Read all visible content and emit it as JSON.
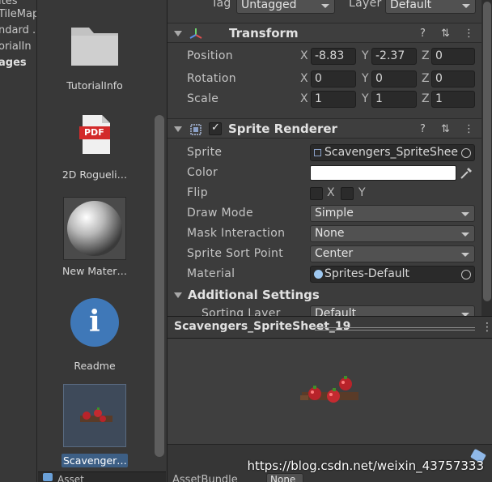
{
  "tree": {
    "items": [
      {
        "label": "ites"
      },
      {
        "label": "TileMap"
      },
      {
        "label": "ndard ."
      },
      {
        "label": "orialIn"
      },
      {
        "label": "ages"
      }
    ]
  },
  "assets": [
    {
      "label": "TutorialInfo",
      "icon": "folder-icon"
    },
    {
      "label": "2D Rogueli…",
      "icon": "pdf-icon",
      "badge": "PDF"
    },
    {
      "label": "New Mater…",
      "icon": "material-sphere-icon"
    },
    {
      "label": "Readme",
      "icon": "info-icon",
      "glyph": "i"
    },
    {
      "label": "Scavenger…",
      "icon": "sprite-thumbnail-icon",
      "selected": true
    }
  ],
  "grid_bottom": {
    "label": "Asset"
  },
  "inspector": {
    "tag_label": "Tag",
    "tag_value": "Untagged",
    "layer_label": "Layer",
    "layer_value": "Default",
    "transform": {
      "title": "Transform",
      "position": {
        "label": "Position",
        "x": "-8.83",
        "y": "-2.37",
        "z": "0"
      },
      "rotation": {
        "label": "Rotation",
        "x": "0",
        "y": "0",
        "z": "0"
      },
      "scale": {
        "label": "Scale",
        "x": "1",
        "y": "1",
        "z": "1"
      }
    },
    "axes": {
      "x": "X",
      "y": "Y",
      "z": "Z"
    },
    "sprite_renderer": {
      "title": "Sprite Renderer",
      "enabled_mark": "✓",
      "sprite": {
        "label": "Sprite",
        "value": "Scavengers_SpriteShee"
      },
      "color": {
        "label": "Color",
        "value": "#ffffff"
      },
      "flip": {
        "label": "Flip",
        "x": "X",
        "y": "Y"
      },
      "draw_mode": {
        "label": "Draw Mode",
        "value": "Simple"
      },
      "mask_interaction": {
        "label": "Mask Interaction",
        "value": "None"
      },
      "sprite_sort_point": {
        "label": "Sprite Sort Point",
        "value": "Center"
      },
      "material": {
        "label": "Material",
        "value": "Sprites-Default"
      }
    },
    "additional_settings": {
      "title": "Additional Settings",
      "sorting_layer": {
        "label": "Sorting Layer",
        "value": "Default"
      }
    },
    "header_icons": {
      "help": "?",
      "settings": "⇅",
      "more": "⋮"
    }
  },
  "preview": {
    "title": "Scavengers_SpriteSheet_19",
    "more": "⋮"
  },
  "bottom": {
    "asset_bundle_label": "AssetBundle",
    "asset_bundle_value": "None"
  },
  "watermark": "https://blog.csdn.net/weixin_43757333"
}
